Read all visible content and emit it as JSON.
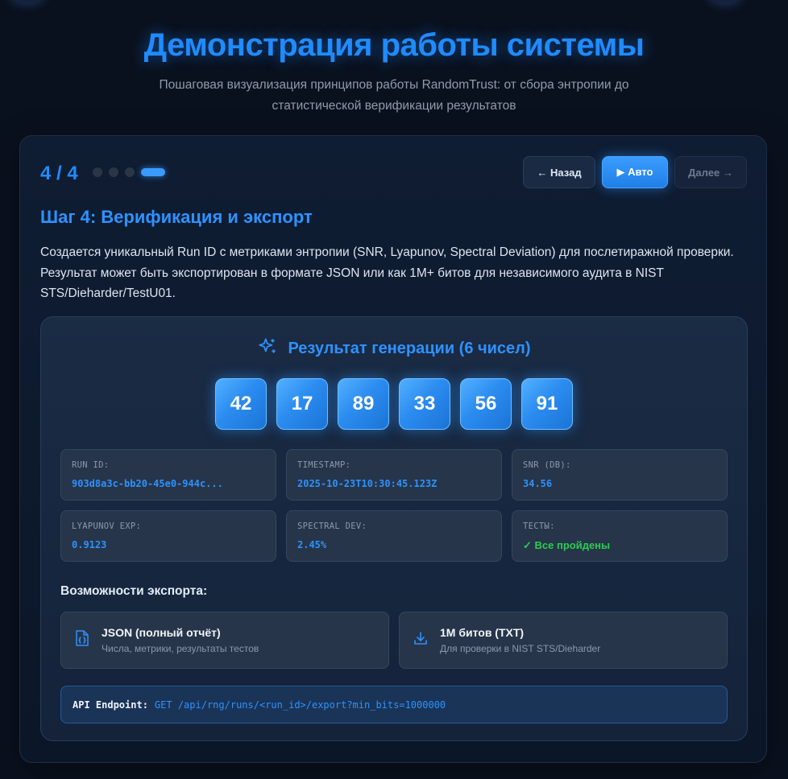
{
  "page": {
    "title": "Демонстрация работы системы",
    "subtitle": "Пошаговая визуализация принципов работы RandomTrust: от сбора энтропии до статистической верификации результатов"
  },
  "stepper": {
    "counter": "4 / 4",
    "total_steps": 4,
    "current_step": 4,
    "back_label": "← Назад",
    "auto_label": "▶ Авто",
    "next_label": "Далее →"
  },
  "step": {
    "title": "Шаг 4: Верификация и экспорт",
    "description": "Создается уникальный Run ID с метриками энтропии (SNR, Lyapunov, Spectral Deviation) для послетиражной проверки. Результат может быть экспортирован в формате JSON или как 1M+ битов для независимого аудита в NIST STS/Dieharder/TestU01."
  },
  "result": {
    "title": "Результат генерации (6 чисел)",
    "icon": "sparkles-icon",
    "numbers": [
      "42",
      "17",
      "89",
      "33",
      "56",
      "91"
    ]
  },
  "metrics": [
    {
      "label": "RUN ID:",
      "value": "903d8a3c-bb20-45e0-944c..."
    },
    {
      "label": "TIMESTAMP:",
      "value": "2025-10-23T10:30:45.123Z"
    },
    {
      "label": "SNR (DB):",
      "value": "34.56"
    },
    {
      "label": "LYAPUNOV EXP:",
      "value": "0.9123"
    },
    {
      "label": "SPECTRAL DEV:",
      "value": "2.45%"
    },
    {
      "label": "ТЕСТЫ:",
      "value": "✓ Все пройдены"
    }
  ],
  "export": {
    "title": "Возможности экспорта:",
    "options": [
      {
        "icon": "json-file-icon",
        "name": "JSON (полный отчёт)",
        "desc": "Числа, метрики, результаты тестов"
      },
      {
        "icon": "download-icon",
        "name": "1M битов (TXT)",
        "desc": "Для проверки в NIST STS/Dieharder"
      }
    ]
  },
  "api": {
    "label": "API Endpoint:",
    "value": "GET /api/rng/runs/<run_id>/export?min_bits=1000000"
  },
  "colors": {
    "accent": "#2e92ff",
    "success": "#2ccc52",
    "background": "#0a111e"
  }
}
